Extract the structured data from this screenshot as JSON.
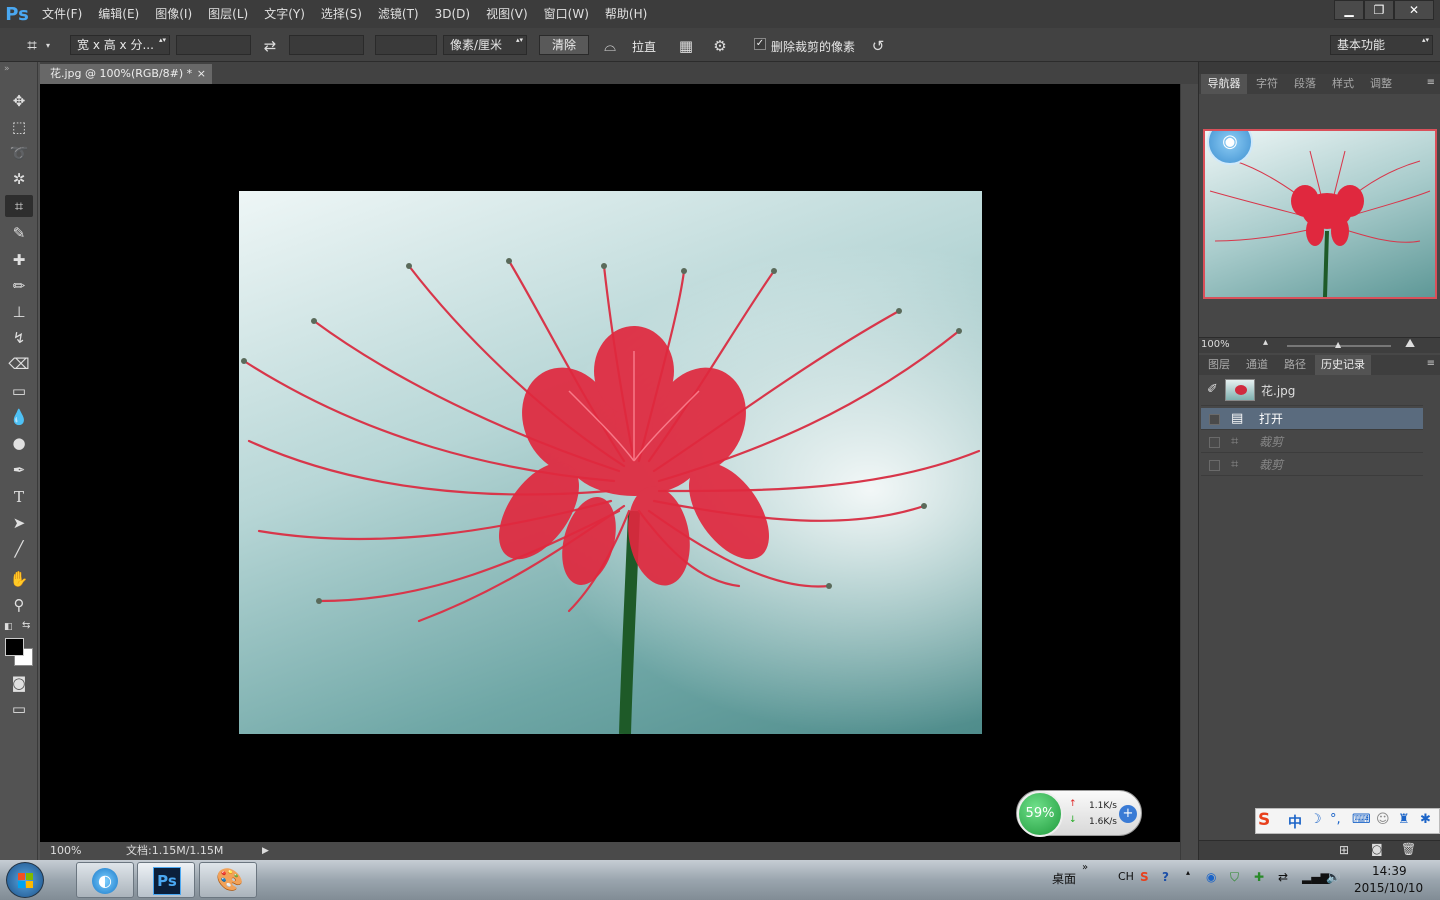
{
  "app": {
    "logo": "Ps"
  },
  "menu": [
    "文件(F)",
    "编辑(E)",
    "图像(I)",
    "图层(L)",
    "文字(Y)",
    "选择(S)",
    "滤镜(T)",
    "3D(D)",
    "视图(V)",
    "窗口(W)",
    "帮助(H)"
  ],
  "window_controls": {
    "minimize": "▁",
    "restore": "❐",
    "close": "✕"
  },
  "options": {
    "ratio_dropdown": "宽 x 高 x 分...",
    "width_value": "",
    "height_value": "",
    "resolution_value": "",
    "unit_dropdown": "像素/厘米",
    "clear_label": "清除",
    "straighten_label": "拉直",
    "delete_cropped_label": "删除裁剪的像素",
    "delete_cropped_checked": true,
    "workspace_dropdown": "基本功能"
  },
  "document": {
    "tab_title": "花.jpg @ 100%(RGB/8#) *",
    "tab_close": "×",
    "zoom": "100%",
    "doc_info": "文档:1.15M/1.15M"
  },
  "panels": {
    "top_tabs": [
      "导航器",
      "字符",
      "段落",
      "样式",
      "调整"
    ],
    "navigator_zoom": "100%",
    "bottom_tabs": [
      "图层",
      "通道",
      "路径",
      "历史记录"
    ],
    "snapshot_name": "花.jpg",
    "history": [
      {
        "label": "打开",
        "selected": true
      },
      {
        "label": "裁剪",
        "selected": false
      },
      {
        "label": "裁剪",
        "selected": false
      }
    ]
  },
  "netmon": {
    "percent": "59%",
    "up": "1.1K/s",
    "down": "1.6K/s"
  },
  "taskbar": {
    "desktop_label": "桌面",
    "lang": "CH",
    "time": "14:39",
    "date": "2015/10/10"
  },
  "ime": {
    "label": "中"
  },
  "colors": {
    "accent": "#4aa8f2",
    "selected_history": "#5a6b7e",
    "canvas_bg": "#000000",
    "panel_bg": "#474747"
  }
}
